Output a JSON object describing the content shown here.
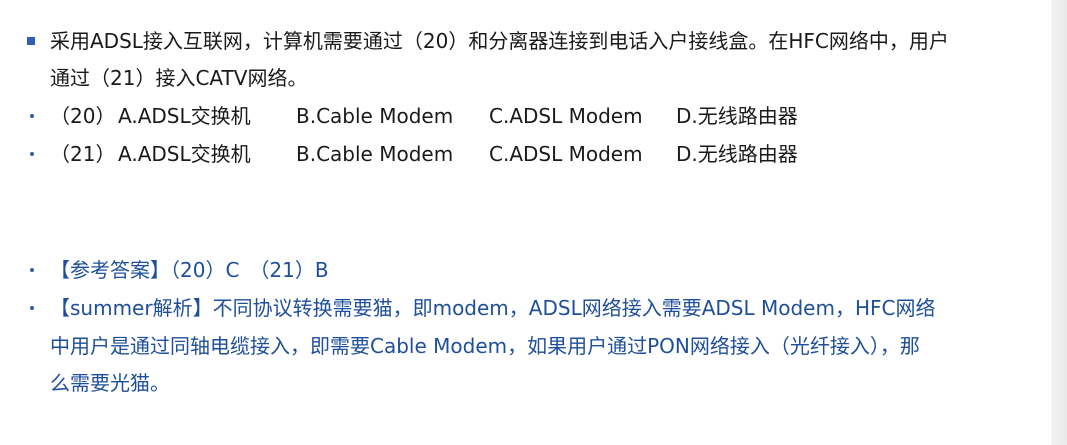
{
  "question": {
    "line1": "采用ADSL接入互联网，计算机需要通过（20）和分离器连接到电话入户接线盒。在HFC网络中，用户",
    "line2": "通过（21）接入CATV网络。"
  },
  "options": [
    {
      "label": "（20）",
      "a": "A.ADSL交换机",
      "b": "B.Cable Modem",
      "c": "C.ADSL Modem",
      "d": "D.无线路由器"
    },
    {
      "label": "（21）",
      "a": "A.ADSL交换机",
      "b": "B.Cable Modem",
      "c": "C.ADSL Modem",
      "d": "D.无线路由器"
    }
  ],
  "answer": {
    "text": "【参考答案】（20）C　（21）B"
  },
  "analysis": {
    "line1": "【summer解析】不同协议转换需要猫，即modem，ADSL网络接入需要ADSL Modem，HFC网络",
    "line2": "中用户是通过同轴电缆接入，即需要Cable Modem，如果用户通过PON网络接入（光纤接入），那",
    "line3": "么需要光猫。"
  },
  "colors": {
    "bullet": "#2f5fb3",
    "answer_text": "#1f4f9a",
    "body_text": "#1a1a1a"
  }
}
